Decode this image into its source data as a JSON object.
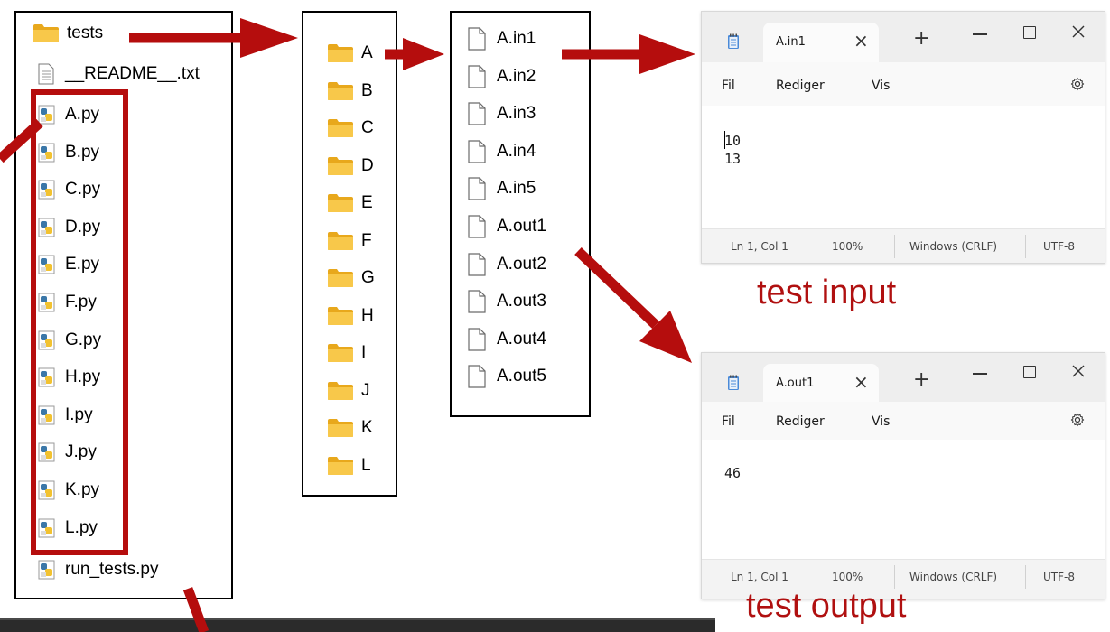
{
  "explorer": {
    "tests_label": "tests",
    "readme_label": "__README__.txt",
    "py_files": [
      "A.py",
      "B.py",
      "C.py",
      "D.py",
      "E.py",
      "F.py",
      "G.py",
      "H.py",
      "I.py",
      "J.py",
      "K.py",
      "L.py"
    ],
    "run_tests_label": "run_tests.py"
  },
  "tests_folder": {
    "subfolders": [
      "A",
      "B",
      "C",
      "D",
      "E",
      "F",
      "G",
      "H",
      "I",
      "J",
      "K",
      "L"
    ]
  },
  "test_files": {
    "files": [
      "A.in1",
      "A.in2",
      "A.in3",
      "A.in4",
      "A.in5",
      "A.out1",
      "A.out2",
      "A.out3",
      "A.out4",
      "A.out5"
    ]
  },
  "notepad_input": {
    "tab_title": "A.in1",
    "close_tab": "×",
    "new_tab": "+",
    "menu": [
      "Fil",
      "Rediger",
      "Vis"
    ],
    "content_lines": [
      "10",
      "13"
    ],
    "status": {
      "position": "Ln 1, Col 1",
      "zoom": "100%",
      "line_ending": "Windows (CRLF)",
      "encoding": "UTF-8"
    }
  },
  "notepad_output": {
    "tab_title": "A.out1",
    "close_tab": "×",
    "new_tab": "+",
    "menu": [
      "Fil",
      "Rediger",
      "Vis"
    ],
    "content_lines": [
      "46"
    ],
    "status": {
      "position": "Ln 1, Col 1",
      "zoom": "100%",
      "line_ending": "Windows (CRLF)",
      "encoding": "UTF-8"
    }
  },
  "captions": {
    "input": "test input",
    "output": "test output"
  },
  "colors": {
    "arrow": "#b50d0d",
    "folder": "#f5c242",
    "caption": "#b01010"
  }
}
